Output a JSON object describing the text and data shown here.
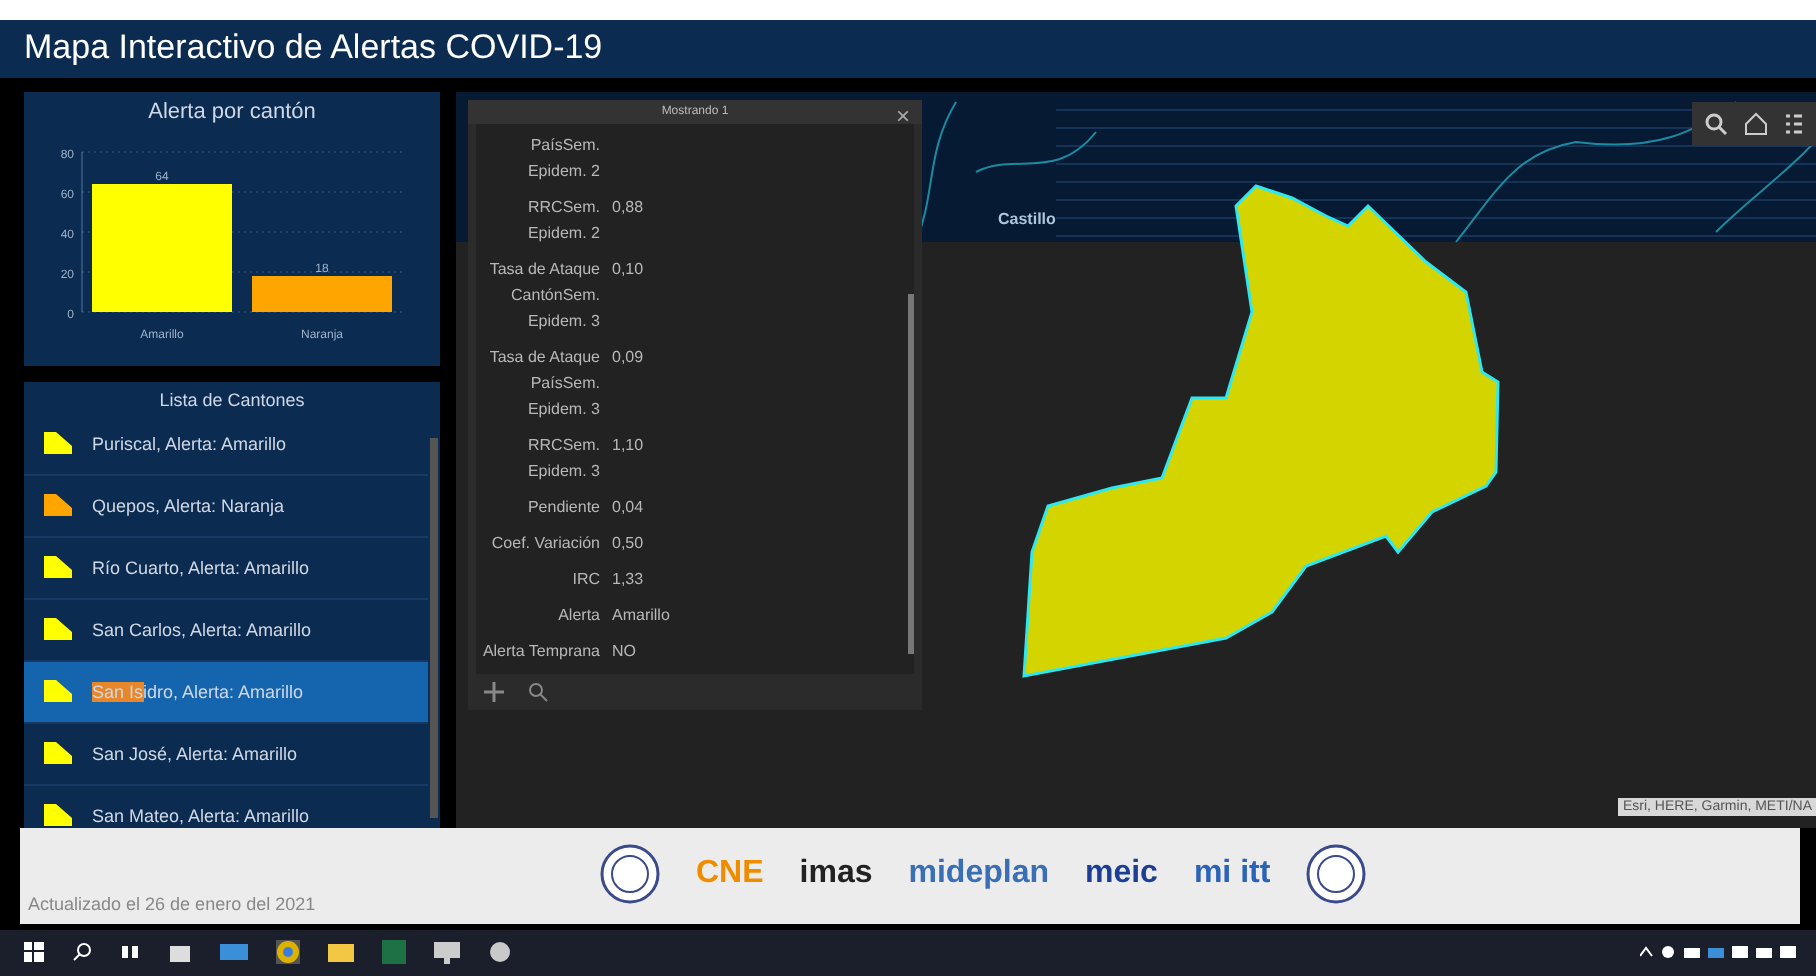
{
  "header": {
    "title": "Mapa Interactivo de Alertas COVID-19"
  },
  "chart_panel": {
    "title": "Alerta por cantón",
    "chart_data": {
      "type": "bar",
      "categories": [
        "Amarillo",
        "Naranja"
      ],
      "grid": true,
      "ylim": [
        0,
        80
      ],
      "yticks": [
        0,
        20,
        40,
        60,
        80
      ],
      "data_labels": true,
      "series": [
        {
          "color": "#ffff00",
          "values": [
            64,
            null
          ]
        },
        {
          "color": "#ffa500",
          "values": [
            null,
            18
          ]
        }
      ]
    }
  },
  "list_panel": {
    "title": "Lista de Cantones",
    "items": [
      {
        "text": "Puriscal, Alerta: Amarillo",
        "color": "#ffff00",
        "selected": false
      },
      {
        "text": "Quepos, Alerta: Naranja",
        "color": "#ffa500",
        "selected": false
      },
      {
        "text": "Río Cuarto, Alerta: Amarillo",
        "color": "#ffff00",
        "selected": false
      },
      {
        "text": "San Carlos, Alerta: Amarillo",
        "color": "#ffff00",
        "selected": false
      },
      {
        "match": "San Is",
        "text": "idro, Alerta: Amarillo",
        "color": "#ffff00",
        "selected": true
      },
      {
        "text": "San José, Alerta: Amarillo",
        "color": "#ffff00",
        "selected": false
      },
      {
        "text": "San Mateo, Alerta: Amarillo",
        "color": "#ffff00",
        "selected": false
      }
    ]
  },
  "popup": {
    "title": "Mostrando 1",
    "close": "×",
    "fields": [
      {
        "label": "PaísSem. Epidem. 2"
      },
      {
        "label": "RRCSem. Epidem. 2",
        "value": "0,88"
      },
      {
        "label": "Tasa de Ataque CantónSem. Epidem. 3",
        "value": "0,10"
      },
      {
        "label": "Tasa de Ataque PaísSem. Epidem. 3",
        "value": "0,09"
      },
      {
        "label": "RRCSem. Epidem. 3",
        "value": "1,10"
      },
      {
        "label": "Pendiente",
        "value": "0,04"
      },
      {
        "label": "Coef. Variación",
        "value": "0,50"
      },
      {
        "label": "IRC",
        "value": "1,33"
      },
      {
        "label": "Alerta",
        "value": "Amarillo"
      },
      {
        "label": "Alerta Temprana",
        "value": "NO"
      }
    ]
  },
  "map": {
    "place_label": "Castillo",
    "attribution": "Esri, HERE, Garmin, METI/NA"
  },
  "footer": {
    "updated": "Actualizado el 26 de enero del 2021",
    "logos": [
      {
        "kind": "seal"
      },
      {
        "kind": "text",
        "text": "CNE",
        "color": "#f08c00"
      },
      {
        "kind": "text",
        "text": "imas",
        "color": "#222222"
      },
      {
        "kind": "text",
        "text": "mideplan",
        "color": "#3a6fb5"
      },
      {
        "kind": "text",
        "text": "meic",
        "color": "#1c3f95"
      },
      {
        "kind": "text",
        "text": "mi itt",
        "color": "#2a63b8"
      },
      {
        "kind": "seal"
      }
    ]
  }
}
